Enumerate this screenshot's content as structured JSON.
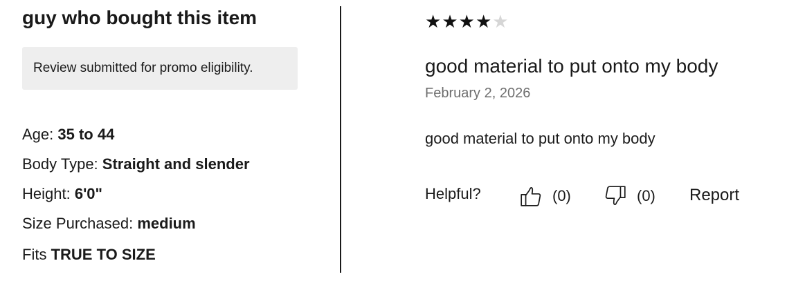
{
  "reviewer": {
    "name": "guy who bought this item",
    "promo_note": "Review submitted for promo eligibility."
  },
  "attributes": {
    "age_label": "Age:",
    "age_value": "35 to 44",
    "body_type_label": "Body Type:",
    "body_type_value": "Straight and slender",
    "height_label": "Height:",
    "height_value": "6'0\"",
    "size_label": "Size Purchased:",
    "size_value": "medium",
    "fit_label": "Fits",
    "fit_value": "TRUE TO SIZE"
  },
  "review": {
    "rating": 4,
    "rating_max": 5,
    "star_filled": "★",
    "star_empty": "★",
    "title": "good material to put onto my body",
    "date": "February 2, 2026",
    "body": "good material to put onto my body"
  },
  "feedback": {
    "helpful_label": "Helpful?",
    "upvote_icon": "thumbs-up-icon",
    "upvote_count": "(0)",
    "downvote_icon": "thumbs-down-icon",
    "downvote_count": "(0)",
    "report_label": "Report"
  },
  "colors": {
    "promo_background": "#eeeeee",
    "star_filled": "#111111",
    "star_empty": "#d6d6d6",
    "date_text": "#6e6e6e"
  }
}
